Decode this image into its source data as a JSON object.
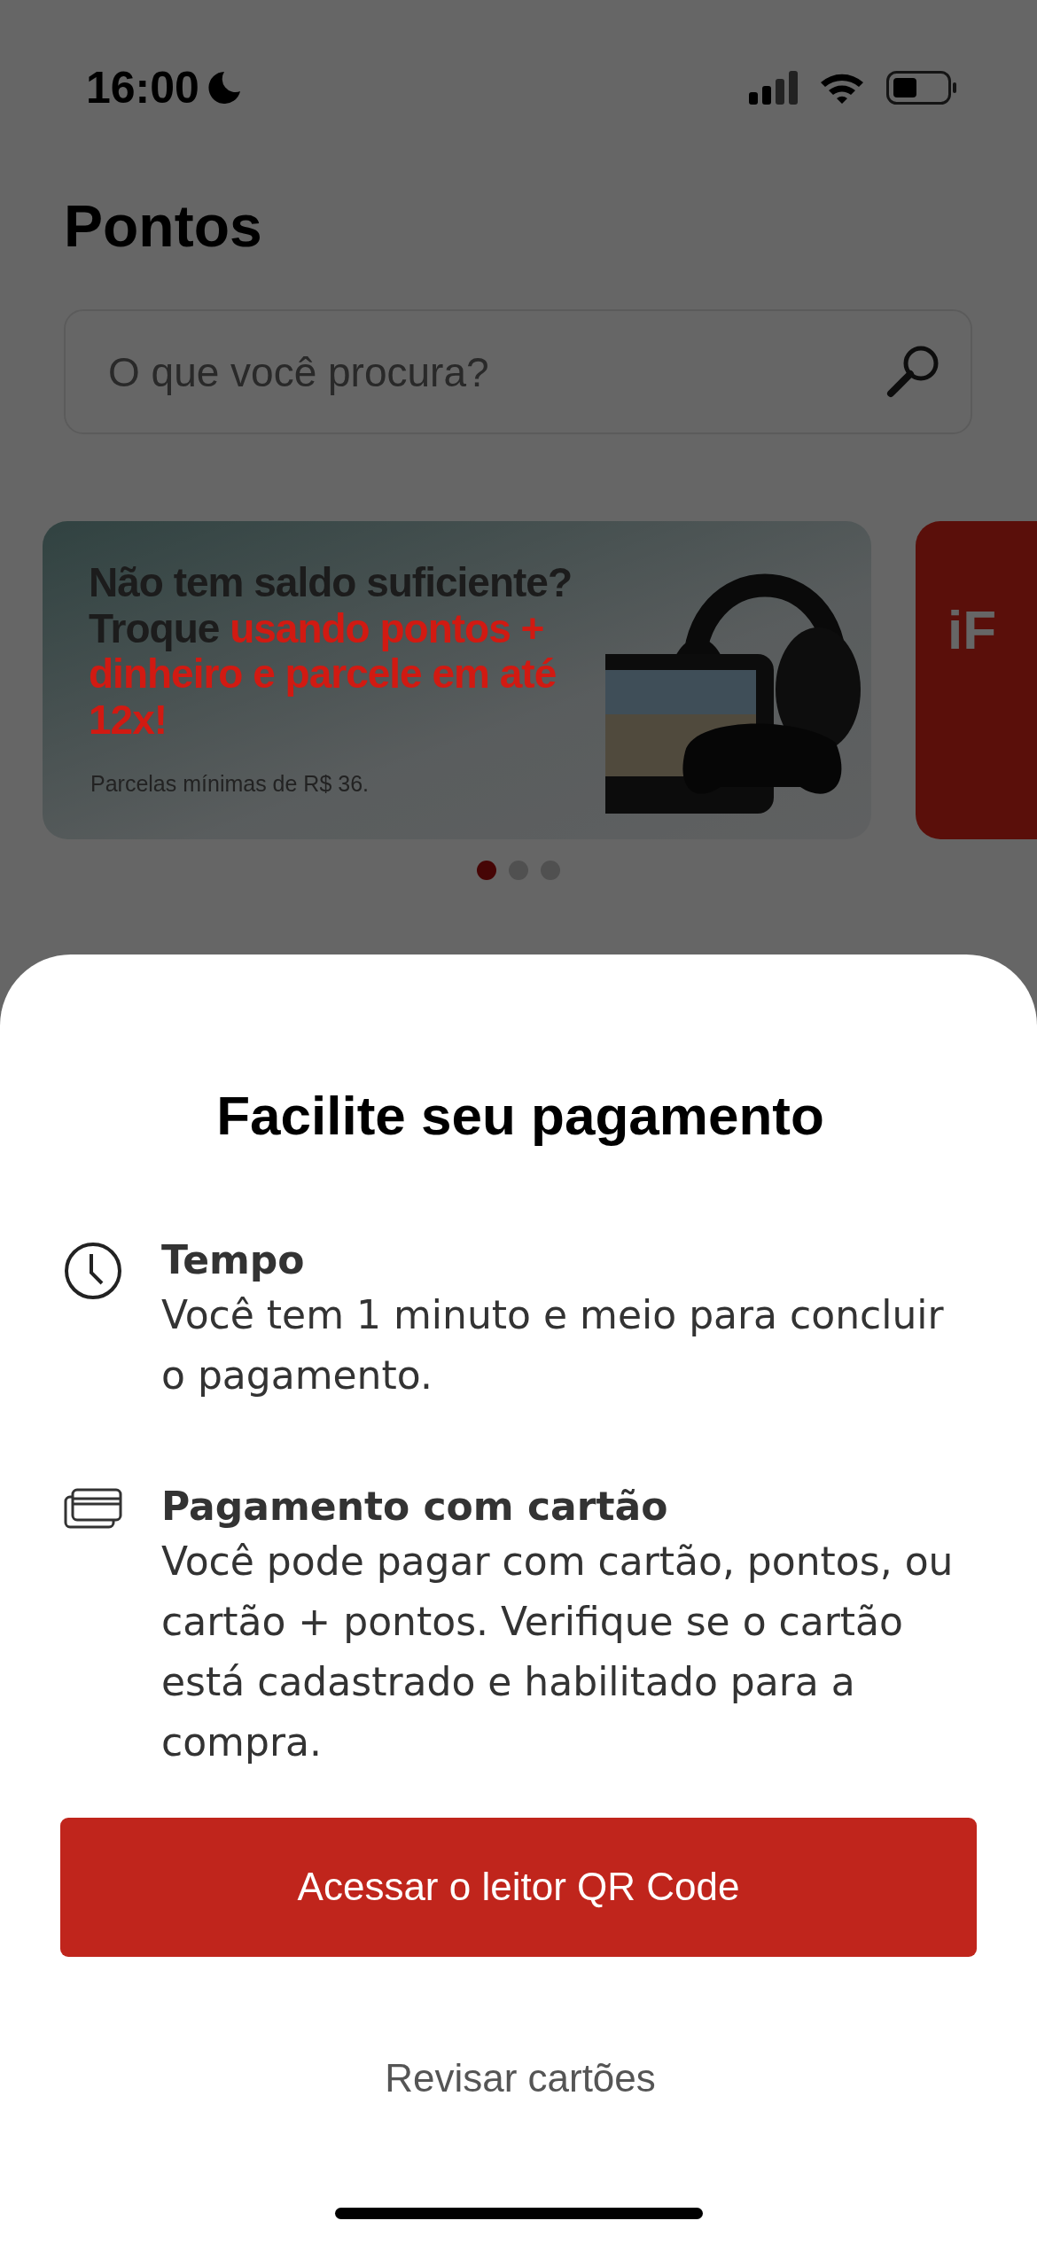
{
  "status_bar": {
    "time": "16:00"
  },
  "page": {
    "title": "Pontos",
    "search": {
      "placeholder": "O que você procura?"
    }
  },
  "banners": [
    {
      "kind": "promo",
      "headline": [
        {
          "text": "Não tem saldo suficiente? Troque ",
          "accent": false
        },
        {
          "text": "usando pontos + dinheiro e parcele em até 12x!",
          "accent": true
        }
      ],
      "note": "Parcelas mínimas de R$ 36."
    },
    {
      "kind": "cut",
      "text": "iF"
    }
  ],
  "carousel_dots": [
    {
      "selected": true
    },
    {
      "selected": false
    },
    {
      "selected": false
    }
  ],
  "sheet": {
    "title": "Facilite seu pagamento",
    "items": [
      {
        "kind": "clock",
        "title": "Tempo",
        "text": "Você tem 1 minuto e meio para concluir o pagamento."
      },
      {
        "kind": "cards",
        "title": "Pagamento com cartão",
        "text": "Você pode pagar com cartão, pontos, ou cartão + pontos. Verifique se o cartão está cadastrado e habilitado para a compra."
      }
    ],
    "primary_button": "Acessar o leitor QR Code",
    "secondary_link": "Revisar cartões"
  }
}
